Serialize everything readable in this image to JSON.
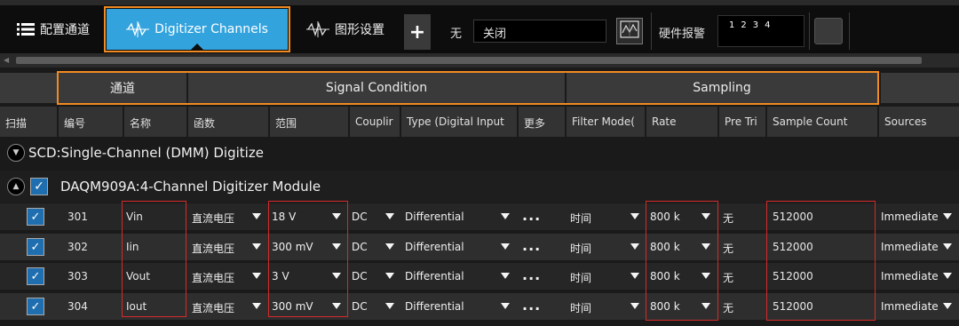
{
  "toolbar": {
    "config_label": "配置通道",
    "digitizer_label": "Digitizer Channels",
    "graphics_label": "图形设置",
    "plus_label": "+",
    "none_label": "无",
    "off_value": "关闭",
    "alarm_label": "硬件报警",
    "alarm_numbers": "1234"
  },
  "groups": {
    "channel": "通道",
    "signal": "Signal Condition",
    "sampling": "Sampling"
  },
  "columns": [
    "扫描",
    "编号",
    "名称",
    "函数",
    "范围",
    "Couplir",
    "Type (Digital Input",
    "更多",
    "Filter Mode(",
    "Rate",
    "Pre Tri",
    "Sample Count",
    "Sources"
  ],
  "tree": {
    "scd": "SCD:Single-Channel (DMM) Digitize",
    "daqm": "DAQM909A:4-Channel Digitizer Module"
  },
  "rows": [
    {
      "num": "301",
      "name": "Vin",
      "func": "直流电压",
      "range": "18 V",
      "coupling": "DC",
      "type": "Differential",
      "more": "...",
      "filter": "时间",
      "rate": "800 k",
      "pretrig": "无",
      "count": "512000",
      "source": "Immediate"
    },
    {
      "num": "302",
      "name": "Iin",
      "func": "直流电压",
      "range": "300 mV",
      "coupling": "DC",
      "type": "Differential",
      "more": "...",
      "filter": "时间",
      "rate": "800 k",
      "pretrig": "无",
      "count": "512000",
      "source": "Immediate"
    },
    {
      "num": "303",
      "name": "Vout",
      "func": "直流电压",
      "range": "3 V",
      "coupling": "DC",
      "type": "Differential",
      "more": "...",
      "filter": "时间",
      "rate": "800 k",
      "pretrig": "无",
      "count": "512000",
      "source": "Immediate"
    },
    {
      "num": "304",
      "name": "Iout",
      "func": "直流电压",
      "range": "300 mV",
      "coupling": "DC",
      "type": "Differential",
      "more": "...",
      "filter": "时间",
      "rate": "800 k",
      "pretrig": "无",
      "count": "512000",
      "source": "Immediate"
    }
  ],
  "colors": {
    "accent": "#33a3de",
    "highlight": "#f08a22",
    "annotation": "#d42a2a"
  }
}
